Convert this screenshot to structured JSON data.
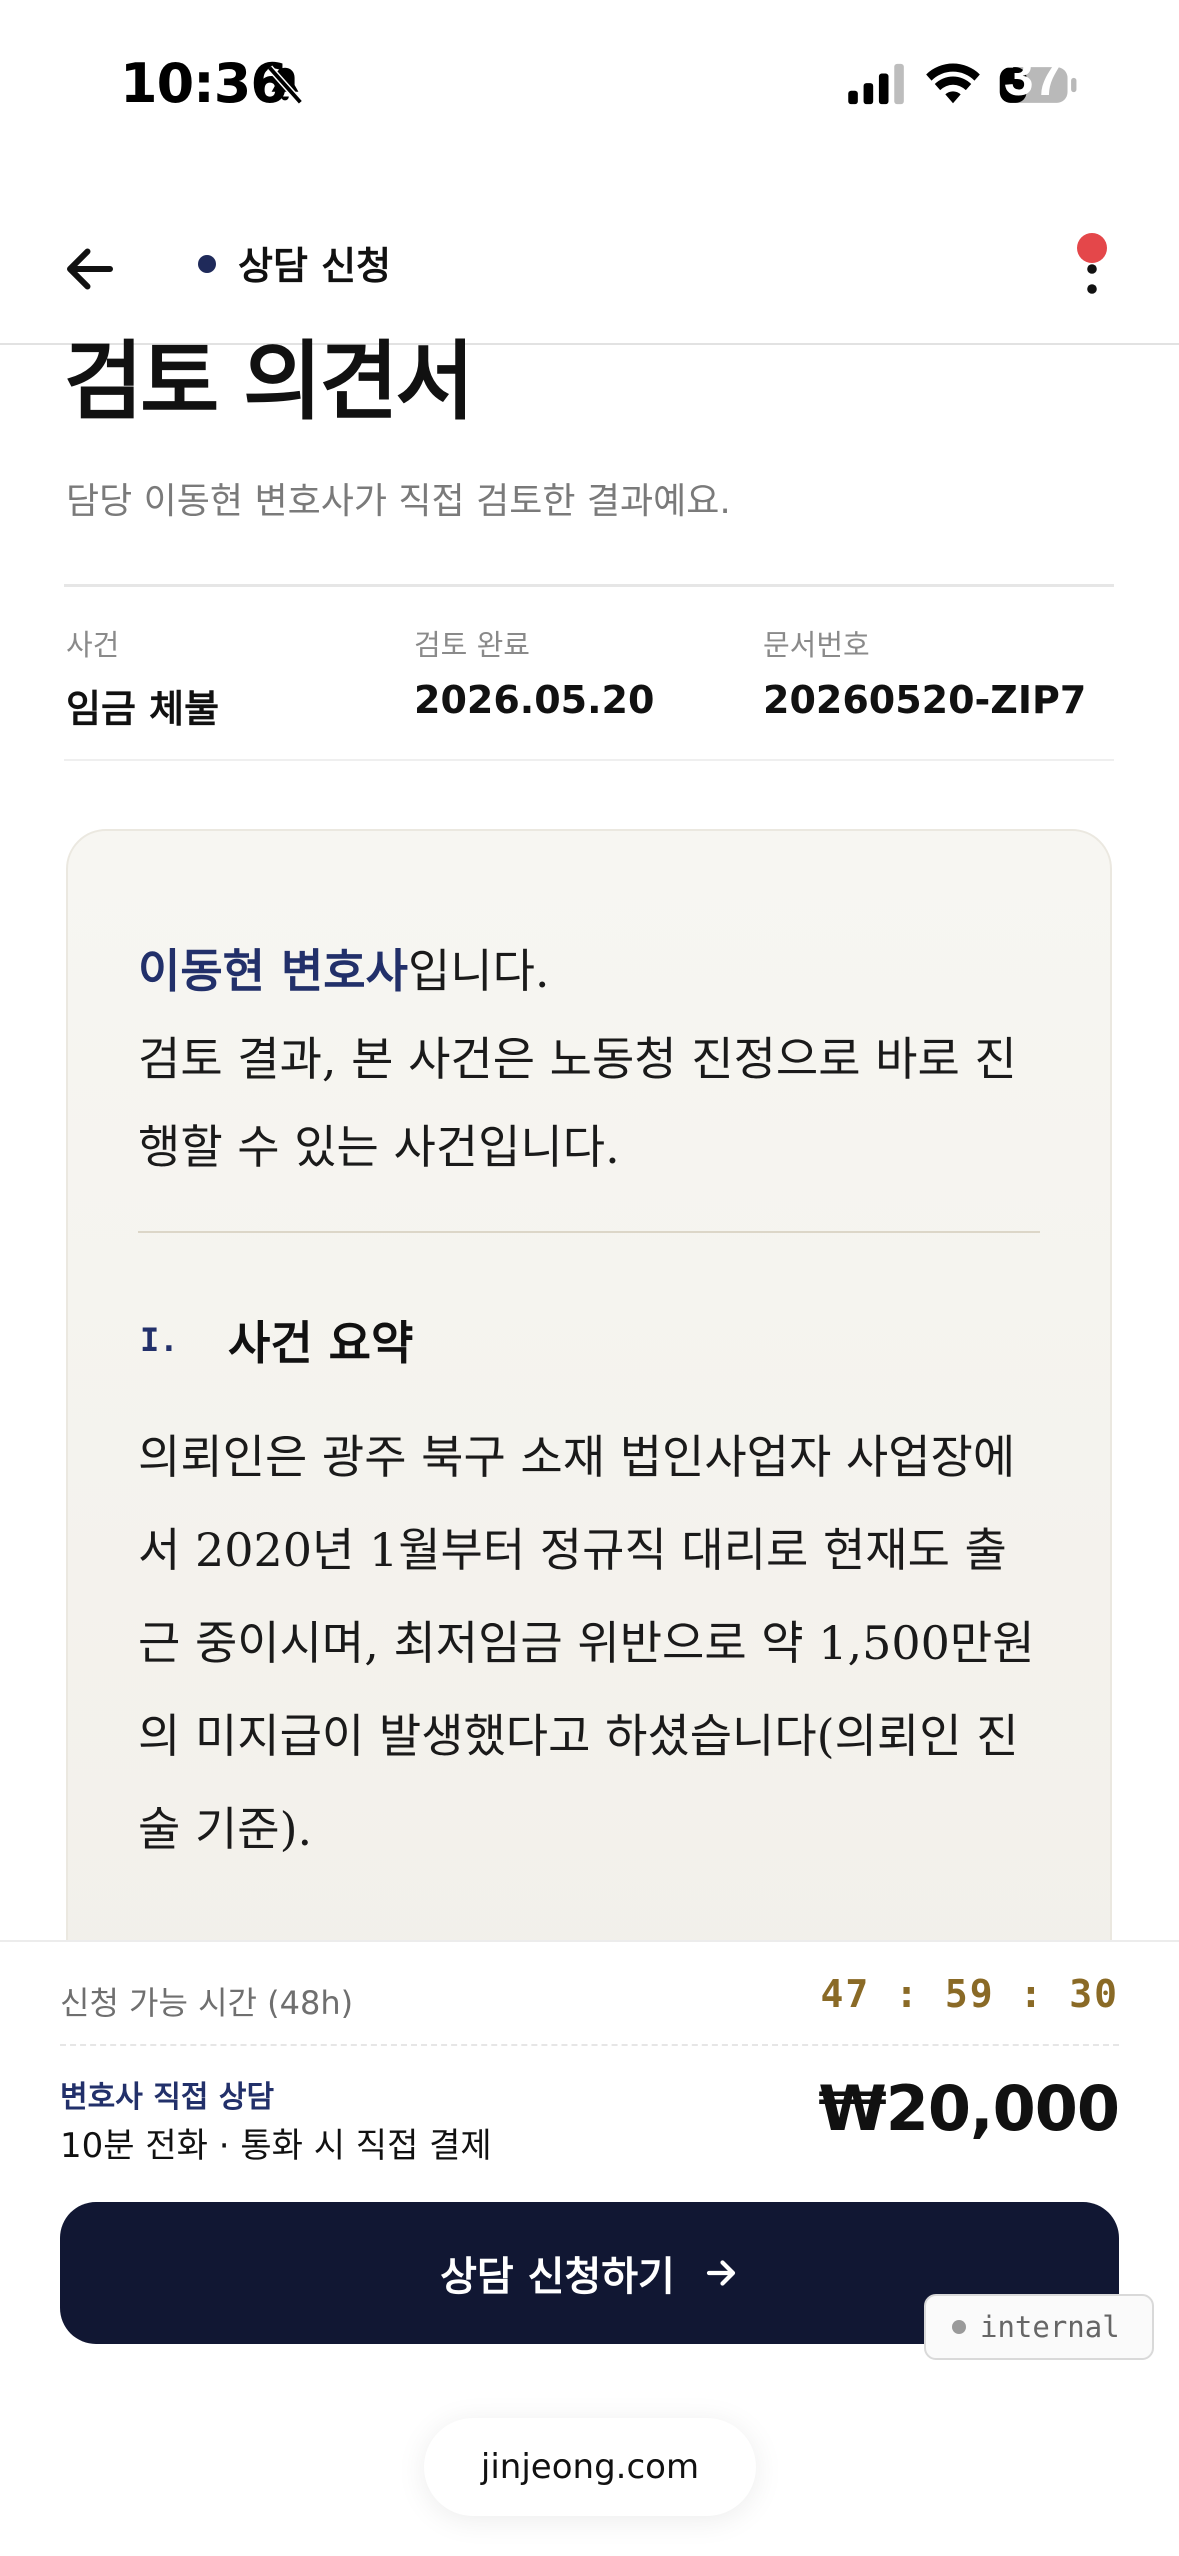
{
  "status_bar": {
    "time": "10:36",
    "battery": "37",
    "icons": [
      "bell-slash-icon",
      "signal-icon",
      "wifi-icon",
      "battery-icon"
    ]
  },
  "nav": {
    "title": "상담 신청",
    "back_icon": "arrow-left-icon",
    "menu_icon": "more-vertical-icon",
    "dot_color": "#1f2a5a",
    "notification_color": "#e4474a"
  },
  "page": {
    "title": "검토 의견서",
    "subtitle": "담당 이동현 변호사가 직접 검토한 결과예요."
  },
  "meta": [
    {
      "label": "사건",
      "value": "임금 체불"
    },
    {
      "label": "검토 완료",
      "value": "2026.05.20"
    },
    {
      "label": "문서번호",
      "value": "20260520-ZIP7"
    }
  ],
  "opinion": {
    "lawyer_name": "이동현 변호사",
    "intro_suffix": "입니다.",
    "intro_line2": "검토 결과, 본 사건은 노동청 진정으로 바로 진행할 수 있는 사건입니다.",
    "section": {
      "number": "I.",
      "title": "사건 요약",
      "body": "의뢰인은 광주 북구 소재 법인사업자 사업장에서 2020년 1월부터 정규직 대리로 현재도 출근 중이시며, 최저임금 위반으로 약 1,500만원의 미지급이 발생했다고 하셨습니다(의뢰인 진술 기준)."
    }
  },
  "bottom": {
    "time_label": "신청 가능 시간 (48h)",
    "countdown": "47 : 59 : 30",
    "consult_label": "변호사 직접 상담",
    "consult_desc": "10분 전화 · 통화 시 직접 결제",
    "price": "₩20,000",
    "cta_label": "상담 신청하기",
    "cta_icon": "arrow-right-icon",
    "internal_badge": "internal",
    "accent_color": "#111733"
  },
  "browser": {
    "url": "jinjeong.com"
  }
}
